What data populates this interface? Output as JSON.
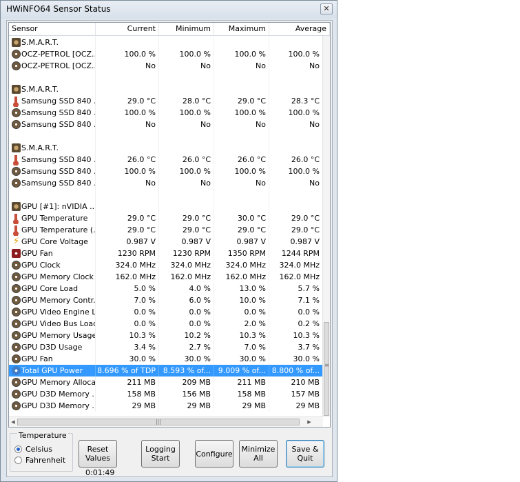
{
  "window": {
    "title": "HWiNFO64 Sensor Status",
    "close_label": "✕"
  },
  "columns": [
    "Sensor",
    "Current",
    "Minimum",
    "Maximum",
    "Average"
  ],
  "rows": [
    {
      "icon": "chip",
      "name": "S.M.A.R.T.",
      "cur": "",
      "min": "",
      "max": "",
      "avg": ""
    },
    {
      "icon": "disc",
      "name": "OCZ-PETROL [OCZ...",
      "cur": "100.0 %",
      "min": "100.0 %",
      "max": "100.0 %",
      "avg": "100.0 %"
    },
    {
      "icon": "disc",
      "name": "OCZ-PETROL [OCZ...",
      "cur": "No",
      "min": "No",
      "max": "No",
      "avg": "No"
    },
    {
      "icon": "",
      "name": "",
      "cur": "",
      "min": "",
      "max": "",
      "avg": ""
    },
    {
      "icon": "chip",
      "name": "S.M.A.R.T.",
      "cur": "",
      "min": "",
      "max": "",
      "avg": ""
    },
    {
      "icon": "therm",
      "name": "Samsung SSD 840 ...",
      "cur": "29.0 °C",
      "min": "28.0 °C",
      "max": "29.0 °C",
      "avg": "28.3 °C"
    },
    {
      "icon": "disc",
      "name": "Samsung SSD 840 ...",
      "cur": "100.0 %",
      "min": "100.0 %",
      "max": "100.0 %",
      "avg": "100.0 %"
    },
    {
      "icon": "disc",
      "name": "Samsung SSD 840 ...",
      "cur": "No",
      "min": "No",
      "max": "No",
      "avg": "No"
    },
    {
      "icon": "",
      "name": "",
      "cur": "",
      "min": "",
      "max": "",
      "avg": ""
    },
    {
      "icon": "chip",
      "name": "S.M.A.R.T.",
      "cur": "",
      "min": "",
      "max": "",
      "avg": ""
    },
    {
      "icon": "therm",
      "name": "Samsung SSD 840 ...",
      "cur": "26.0 °C",
      "min": "26.0 °C",
      "max": "26.0 °C",
      "avg": "26.0 °C"
    },
    {
      "icon": "disc",
      "name": "Samsung SSD 840 ...",
      "cur": "100.0 %",
      "min": "100.0 %",
      "max": "100.0 %",
      "avg": "100.0 %"
    },
    {
      "icon": "disc",
      "name": "Samsung SSD 840 ...",
      "cur": "No",
      "min": "No",
      "max": "No",
      "avg": "No"
    },
    {
      "icon": "",
      "name": "",
      "cur": "",
      "min": "",
      "max": "",
      "avg": ""
    },
    {
      "icon": "chip",
      "name": "GPU [#1]: nVIDIA ...",
      "cur": "",
      "min": "",
      "max": "",
      "avg": ""
    },
    {
      "icon": "therm",
      "name": "GPU Temperature",
      "cur": "29.0 °C",
      "min": "29.0 °C",
      "max": "30.0 °C",
      "avg": "29.0 °C"
    },
    {
      "icon": "therm",
      "name": "GPU Temperature (...",
      "cur": "29.0 °C",
      "min": "29.0 °C",
      "max": "29.0 °C",
      "avg": "29.0 °C"
    },
    {
      "icon": "bolt",
      "name": "GPU Core Voltage",
      "cur": "0.987 V",
      "min": "0.987 V",
      "max": "0.987 V",
      "avg": "0.987 V"
    },
    {
      "icon": "fan",
      "name": "GPU Fan",
      "cur": "1230 RPM",
      "min": "1230 RPM",
      "max": "1350 RPM",
      "avg": "1244 RPM"
    },
    {
      "icon": "disc",
      "name": "GPU Clock",
      "cur": "324.0 MHz",
      "min": "324.0 MHz",
      "max": "324.0 MHz",
      "avg": "324.0 MHz"
    },
    {
      "icon": "disc",
      "name": "GPU Memory Clock",
      "cur": "162.0 MHz",
      "min": "162.0 MHz",
      "max": "162.0 MHz",
      "avg": "162.0 MHz"
    },
    {
      "icon": "disc",
      "name": "GPU Core Load",
      "cur": "5.0 %",
      "min": "4.0 %",
      "max": "13.0 %",
      "avg": "5.7 %"
    },
    {
      "icon": "disc",
      "name": "GPU Memory Contr...",
      "cur": "7.0 %",
      "min": "6.0 %",
      "max": "10.0 %",
      "avg": "7.1 %"
    },
    {
      "icon": "disc",
      "name": "GPU Video Engine L...",
      "cur": "0.0 %",
      "min": "0.0 %",
      "max": "0.0 %",
      "avg": "0.0 %"
    },
    {
      "icon": "disc",
      "name": "GPU Video Bus Load",
      "cur": "0.0 %",
      "min": "0.0 %",
      "max": "2.0 %",
      "avg": "0.2 %"
    },
    {
      "icon": "disc",
      "name": "GPU Memory Usage",
      "cur": "10.3 %",
      "min": "10.2 %",
      "max": "10.3 %",
      "avg": "10.3 %"
    },
    {
      "icon": "disc",
      "name": "GPU D3D Usage",
      "cur": "3.4 %",
      "min": "2.7 %",
      "max": "7.0 %",
      "avg": "3.7 %"
    },
    {
      "icon": "disc",
      "name": "GPU Fan",
      "cur": "30.0 %",
      "min": "30.0 %",
      "max": "30.0 %",
      "avg": "30.0 %"
    },
    {
      "icon": "power",
      "name": "Total GPU Power",
      "cur": "8.696 % of TDP",
      "min": "8.593 % of...",
      "max": "9.009 % of...",
      "avg": "8.800 % of...",
      "selected": true
    },
    {
      "icon": "disc",
      "name": "GPU Memory Alloca...",
      "cur": "211 MB",
      "min": "209 MB",
      "max": "211 MB",
      "avg": "210 MB"
    },
    {
      "icon": "disc",
      "name": "GPU D3D Memory ...",
      "cur": "158 MB",
      "min": "156 MB",
      "max": "158 MB",
      "avg": "157 MB"
    },
    {
      "icon": "disc",
      "name": "GPU D3D Memory ...",
      "cur": "29 MB",
      "min": "29 MB",
      "max": "29 MB",
      "avg": "29 MB"
    }
  ],
  "scrollbar": {
    "grip": "≡",
    "left_arrow": "◀",
    "right_arrow": "▶",
    "h_grip": "|||"
  },
  "temperature_group": {
    "title": "Temperature",
    "celsius": "Celsius",
    "fahrenheit": "Fahrenheit",
    "selected": "Celsius"
  },
  "buttons": {
    "reset": "Reset Values",
    "logging": "Logging Start",
    "configure": "Configure",
    "minimize": "Minimize All",
    "save": "Save & Quit"
  },
  "timer": "0:01:49"
}
